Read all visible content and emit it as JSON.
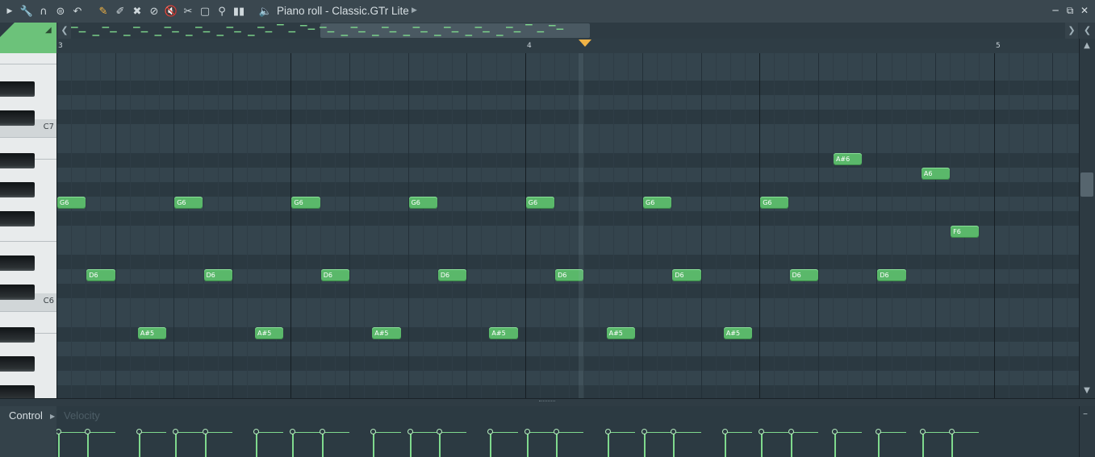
{
  "window": {
    "title": "Piano roll - Classic.GTr Lite"
  },
  "toolbar_icons": [
    "menu-arrow-icon",
    "wrench-icon",
    "magnet-icon",
    "snap-menu-icon",
    "undo-icon",
    "pencil-icon",
    "paint-brush-icon",
    "delete-brush-icon",
    "mute-icon",
    "speaker-mute-icon",
    "slice-icon",
    "select-icon",
    "zoom-icon",
    "playback-icon",
    "audio-preview-icon"
  ],
  "timeline": {
    "bars": [
      "3",
      "4",
      "5"
    ]
  },
  "keyboard": {
    "labels": [
      "C7",
      "C6"
    ]
  },
  "notes": [
    {
      "label": "G6",
      "row": 10,
      "start": 0.0,
      "len": 0.5
    },
    {
      "label": "G6",
      "row": 10,
      "start": 2.0,
      "len": 0.5
    },
    {
      "label": "G6",
      "row": 10,
      "start": 4.0,
      "len": 0.5
    },
    {
      "label": "G6",
      "row": 10,
      "start": 6.0,
      "len": 0.5
    },
    {
      "label": "G6",
      "row": 10,
      "start": 8.0,
      "len": 0.5
    },
    {
      "label": "G6",
      "row": 10,
      "start": 10.0,
      "len": 0.5
    },
    {
      "label": "G6",
      "row": 10,
      "start": 12.0,
      "len": 0.5
    },
    {
      "label": "D6",
      "row": 15,
      "start": 0.5,
      "len": 0.5
    },
    {
      "label": "D6",
      "row": 15,
      "start": 2.5,
      "len": 0.5
    },
    {
      "label": "D6",
      "row": 15,
      "start": 4.5,
      "len": 0.5
    },
    {
      "label": "D6",
      "row": 15,
      "start": 6.5,
      "len": 0.5
    },
    {
      "label": "D6",
      "row": 15,
      "start": 8.5,
      "len": 0.5
    },
    {
      "label": "D6",
      "row": 15,
      "start": 10.5,
      "len": 0.5
    },
    {
      "label": "D6",
      "row": 15,
      "start": 12.5,
      "len": 0.5
    },
    {
      "label": "D6",
      "row": 15,
      "start": 14.0,
      "len": 0.5
    },
    {
      "label": "A#5",
      "row": 19,
      "start": 1.375,
      "len": 0.5
    },
    {
      "label": "A#5",
      "row": 19,
      "start": 3.375,
      "len": 0.5
    },
    {
      "label": "A#5",
      "row": 19,
      "start": 5.375,
      "len": 0.5
    },
    {
      "label": "A#5",
      "row": 19,
      "start": 7.375,
      "len": 0.5
    },
    {
      "label": "A#5",
      "row": 19,
      "start": 9.375,
      "len": 0.5
    },
    {
      "label": "A#5",
      "row": 19,
      "start": 11.375,
      "len": 0.5
    },
    {
      "label": "A#6",
      "row": 7,
      "start": 13.25,
      "len": 0.5
    },
    {
      "label": "A6",
      "row": 8,
      "start": 14.75,
      "len": 0.5
    },
    {
      "label": "F6",
      "row": 12,
      "start": 15.25,
      "len": 0.5
    }
  ],
  "control": {
    "label": "Control",
    "target": "Velocity"
  },
  "colors": {
    "note": "#5ab86a",
    "accent": "#f0b346",
    "background": "#2a3740"
  }
}
